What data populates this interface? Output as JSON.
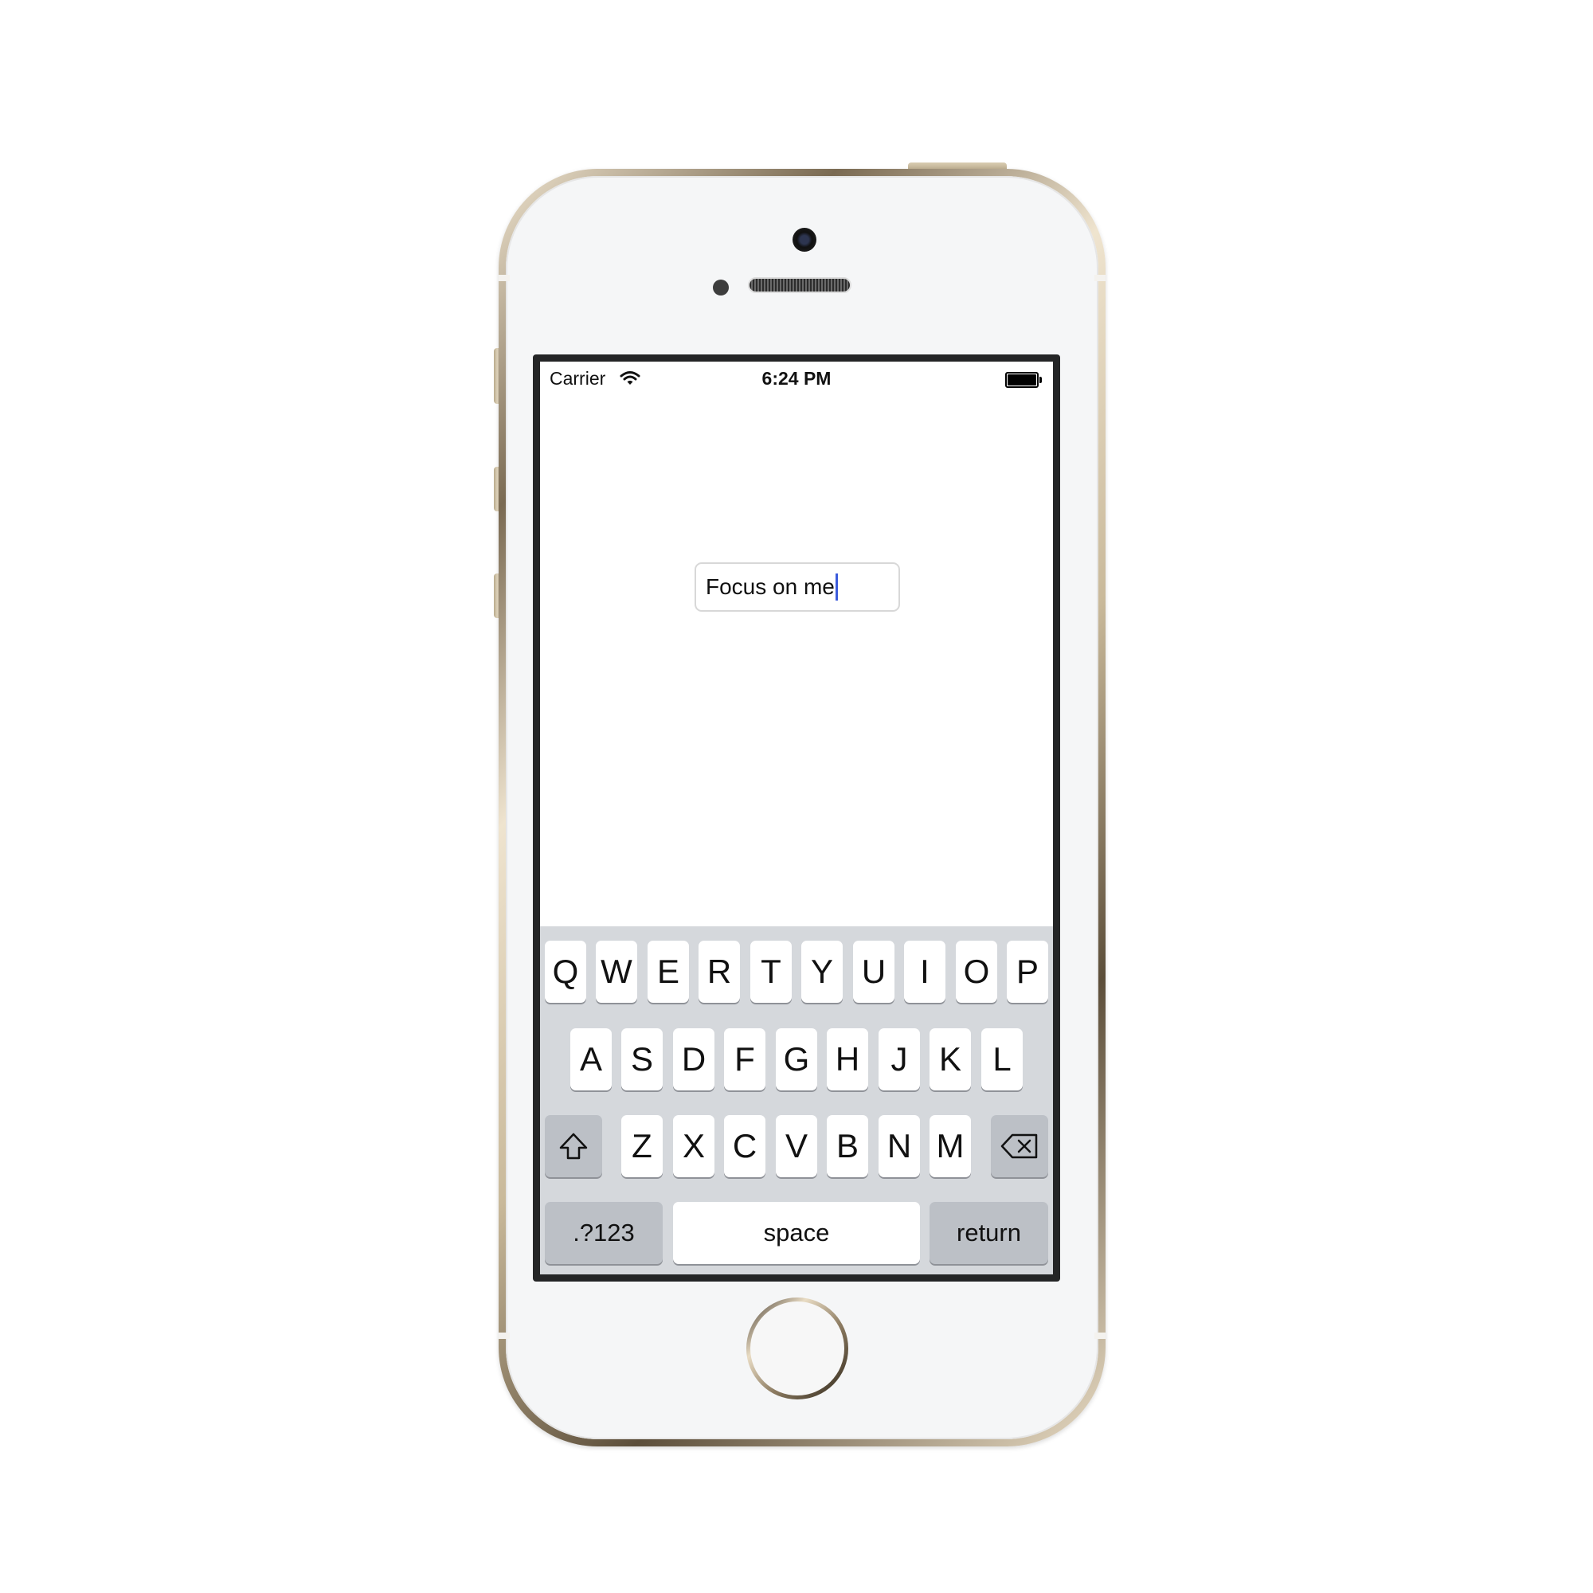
{
  "status_bar": {
    "carrier": "Carrier",
    "time": "6:24 PM",
    "wifi_icon": "wifi-icon",
    "battery_icon": "battery-icon"
  },
  "text_field": {
    "value": "Focus on me"
  },
  "keyboard": {
    "row1": [
      "Q",
      "W",
      "E",
      "R",
      "T",
      "Y",
      "U",
      "I",
      "O",
      "P"
    ],
    "row2": [
      "A",
      "S",
      "D",
      "F",
      "G",
      "H",
      "J",
      "K",
      "L"
    ],
    "row3": [
      "Z",
      "X",
      "C",
      "V",
      "B",
      "N",
      "M"
    ],
    "shift_icon": "shift-icon",
    "delete_icon": "delete-icon",
    "numbers_label": ".?123",
    "space_label": "space",
    "return_label": "return"
  },
  "colors": {
    "caret": "#3b5bdb",
    "keyboard_bg": "#d5d8dc",
    "key_bg": "#ffffff",
    "special_key_bg": "#bcc0c6"
  }
}
